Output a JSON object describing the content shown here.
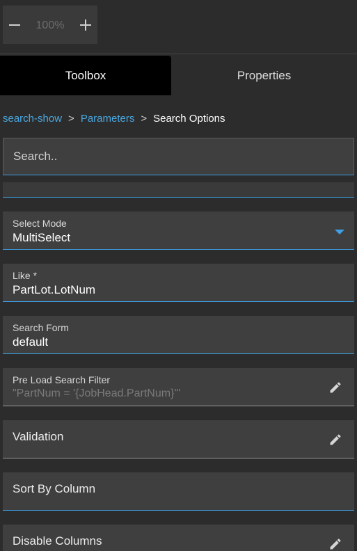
{
  "zoom": {
    "level": "100%",
    "zoom_out_icon": "minus-icon",
    "zoom_in_icon": "plus-icon"
  },
  "tabs": [
    {
      "label": "Toolbox",
      "active": true
    },
    {
      "label": "Properties",
      "active": false
    }
  ],
  "breadcrumb": {
    "items": [
      "search-show",
      "Parameters",
      "Search Options"
    ],
    "separator": ">"
  },
  "search": {
    "placeholder": "Search.."
  },
  "fields": {
    "select_mode": {
      "label": "Select Mode",
      "value": "MultiSelect",
      "icon": "dropdown-arrow-icon"
    },
    "like": {
      "label": "Like *",
      "value": "PartLot.LotNum"
    },
    "search_form": {
      "label": "Search Form",
      "value": "default"
    },
    "pre_load_filter": {
      "label": "Pre Load Search Filter",
      "placeholder": "\"PartNum = '{JobHead.PartNum}'\"",
      "icon": "pencil-icon"
    },
    "validation": {
      "label": "Validation",
      "icon": "pencil-icon"
    },
    "sort_by_column": {
      "label": "Sort By Column"
    },
    "disable_columns": {
      "label": "Disable Columns",
      "icon": "pencil-icon"
    }
  },
  "colors": {
    "background": "#2c2c2c",
    "field_background": "#3f3f3f",
    "accent": "#3ea0e6",
    "link": "#4aa8e0",
    "active_tab": "#000000"
  }
}
